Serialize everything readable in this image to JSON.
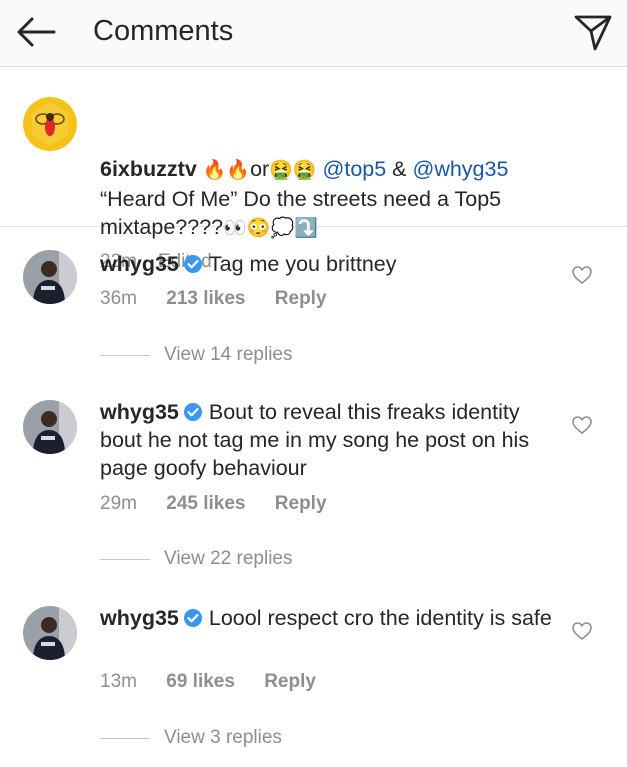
{
  "header": {
    "title": "Comments"
  },
  "caption": {
    "username": "6ixbuzztv",
    "emoji_prefix": "🔥🔥",
    "or_text": "or",
    "emoji_mid": "🤮🤮",
    "mention1": "@top5",
    "amp": " & ",
    "mention2": "@whyg35",
    "text": "“Heard Of Me” Do the streets need a Top5 mixtape????",
    "emoji_suffix": "👀😳💭⤵️",
    "time": "22m",
    "edited": "· Edited"
  },
  "comments": [
    {
      "username": "whyg35",
      "text": "Tag me you brittney",
      "time": "36m",
      "likes": "213 likes",
      "reply": "Reply",
      "view_replies": "View 14 replies"
    },
    {
      "username": "whyg35",
      "text": "Bout to reveal this freaks identity bout he not tag me in my song he post on his page goofy behaviour",
      "time": "29m",
      "likes": "245 likes",
      "reply": "Reply",
      "view_replies": "View 22 replies"
    },
    {
      "username": "whyg35",
      "text": "Loool respect cro the identity is safe",
      "time": "13m",
      "likes": "69 likes",
      "reply": "Reply",
      "view_replies": "View 3 replies"
    }
  ],
  "colors": {
    "link": "#1a56a6",
    "verified": "#3897f0",
    "meta": "#8e8e8e",
    "avatar_yellow": "#f6c21a"
  }
}
